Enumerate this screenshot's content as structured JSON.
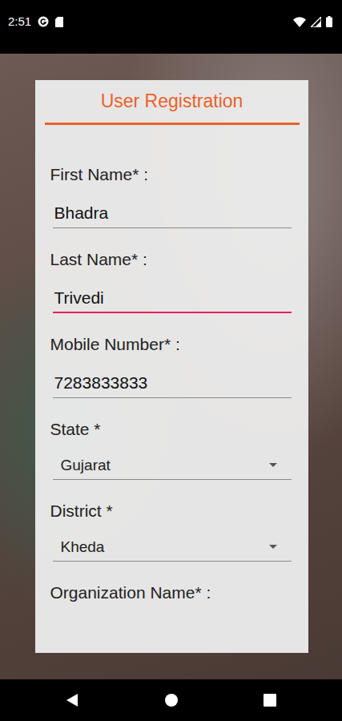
{
  "status_bar": {
    "time": "2:51"
  },
  "form": {
    "title": "User Registration",
    "fields": [
      {
        "label": "First Name* :",
        "value": "Bhadra",
        "kind": "text",
        "focused": false
      },
      {
        "label": "Last Name* :",
        "value": "Trivedi",
        "kind": "text",
        "focused": true
      },
      {
        "label": "Mobile Number* :",
        "value": "7283833833",
        "kind": "text",
        "focused": false
      },
      {
        "label": "State *",
        "value": "Gujarat",
        "kind": "select",
        "focused": false
      },
      {
        "label": "District *",
        "value": "Kheda",
        "kind": "select",
        "focused": false
      },
      {
        "label": "Organization Name* :",
        "kind": "text",
        "focused": false
      }
    ]
  }
}
